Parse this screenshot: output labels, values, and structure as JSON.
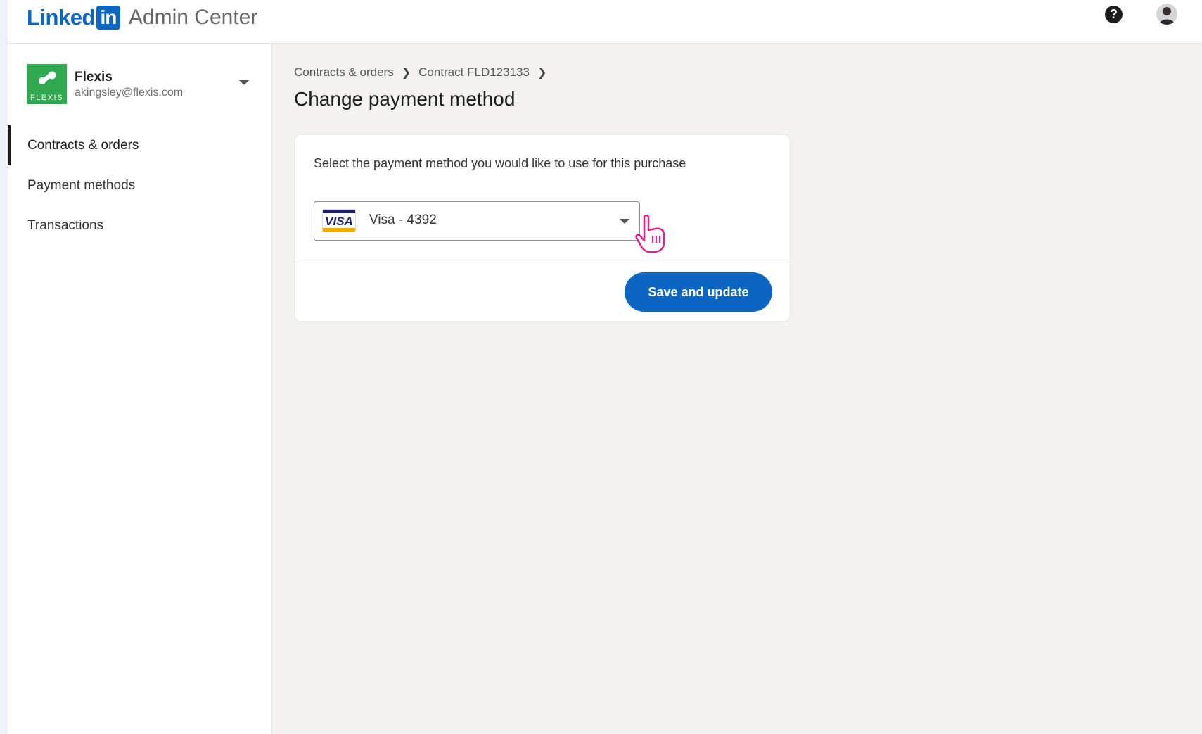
{
  "header": {
    "brand_word": "Linked",
    "brand_box": "in",
    "product_name": "Admin Center",
    "help_icon": "?",
    "icons": {
      "help": "question-circle-icon",
      "avatar": "user-avatar"
    }
  },
  "sidebar": {
    "org": {
      "name": "Flexis",
      "email": "akingsley@flexis.com",
      "logo_text": "FLEXIS"
    },
    "items": [
      {
        "label": "Contracts & orders",
        "active": true
      },
      {
        "label": "Payment methods",
        "active": false
      },
      {
        "label": "Transactions",
        "active": false
      }
    ]
  },
  "breadcrumb": [
    "Contracts & orders",
    "Contract FLD123133"
  ],
  "page": {
    "title": "Change payment method"
  },
  "payment": {
    "instruction": "Select the payment method you would like to use for this purchase",
    "card_brand": "VISA",
    "selected": "Visa - 4392",
    "save_label": "Save and update"
  },
  "colors": {
    "accent": "#0a66c2",
    "cursor": "#e0218a",
    "org_logo": "#2fa84f"
  }
}
